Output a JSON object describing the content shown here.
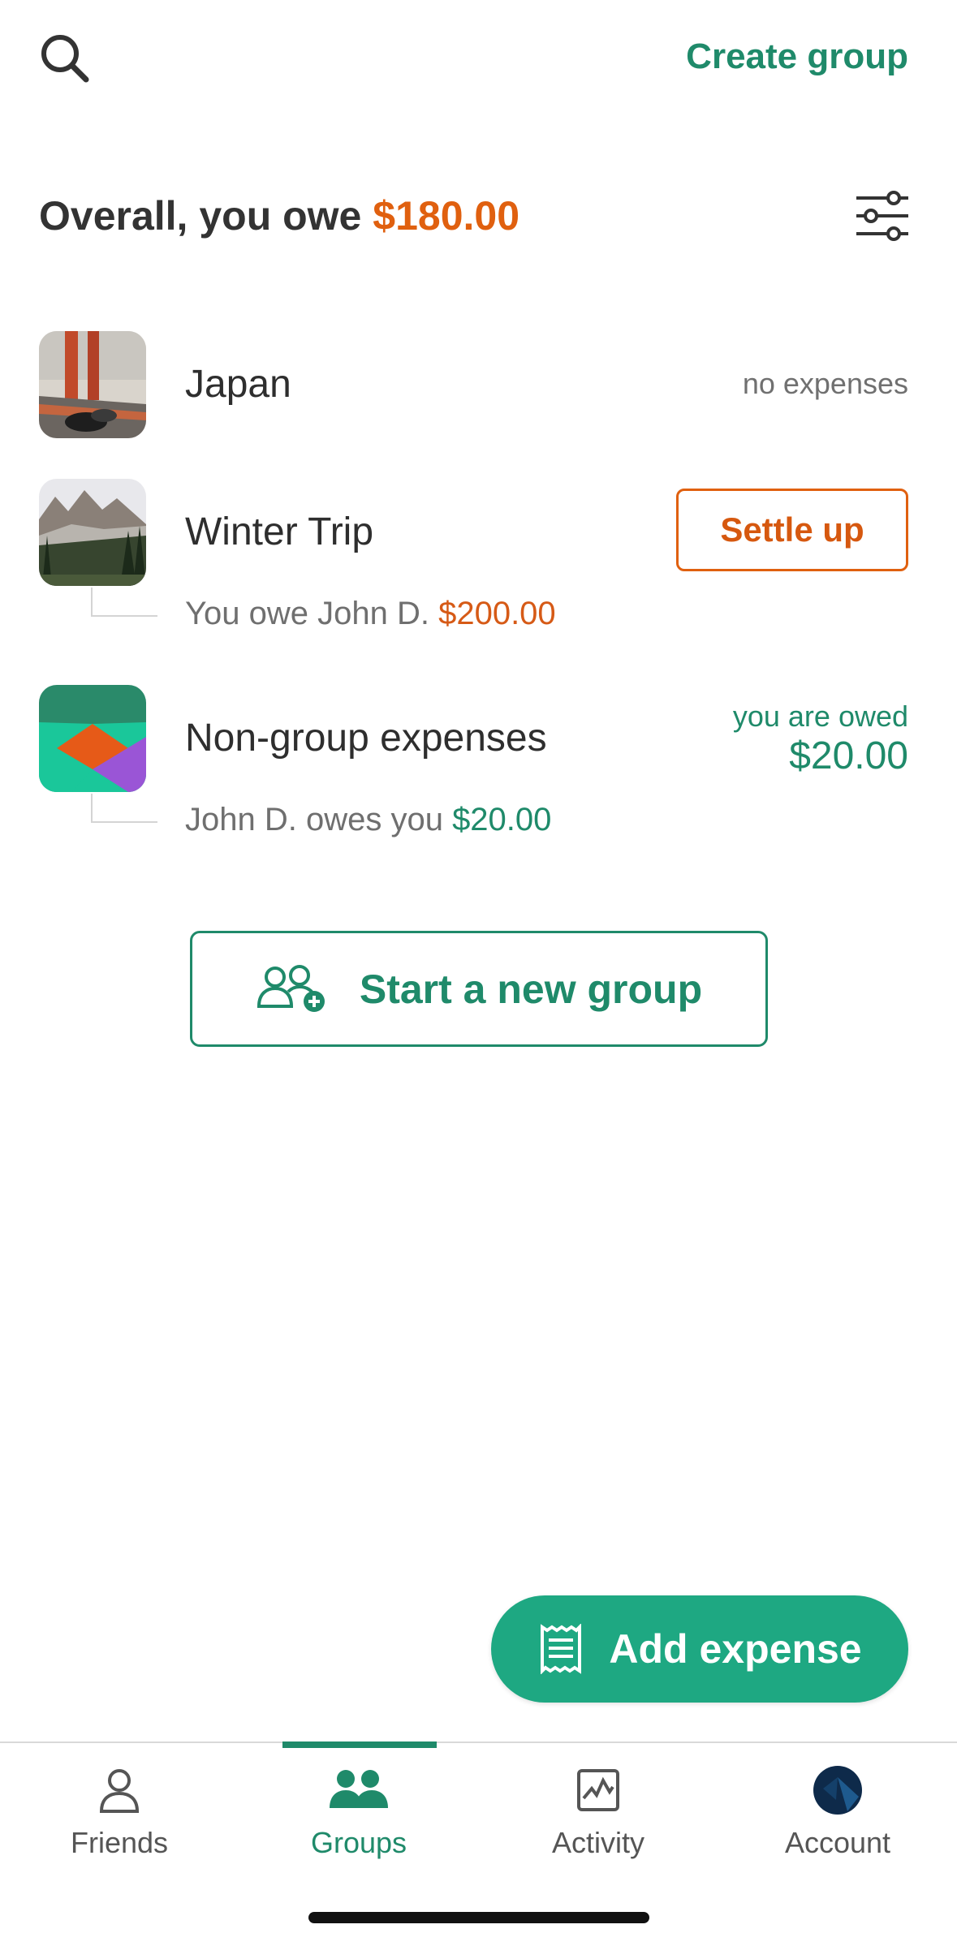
{
  "header": {
    "create_group_label": "Create group"
  },
  "summary": {
    "prefix": "Overall, you owe ",
    "amount": "$180.00"
  },
  "groups": [
    {
      "name": "Japan",
      "status": "no expenses"
    },
    {
      "name": "Winter Trip",
      "action_label": "Settle up",
      "detail_prefix": "You owe John D. ",
      "detail_amount": "$200.00"
    },
    {
      "name": "Non-group expenses",
      "status_label": "you are owed",
      "status_amount": "$20.00",
      "detail_prefix": "John D. owes you ",
      "detail_amount": "$20.00"
    }
  ],
  "new_group_label": "Start a new group",
  "add_expense_label": "Add expense",
  "tabs": [
    {
      "label": "Friends",
      "icon": "person-icon"
    },
    {
      "label": "Groups",
      "icon": "group-icon",
      "active": true
    },
    {
      "label": "Activity",
      "icon": "activity-icon"
    },
    {
      "label": "Account",
      "icon": "avatar-icon"
    }
  ],
  "colors": {
    "brand_green": "#1f8a6a",
    "owe_orange": "#e0600f",
    "button_green": "#1ea882"
  }
}
